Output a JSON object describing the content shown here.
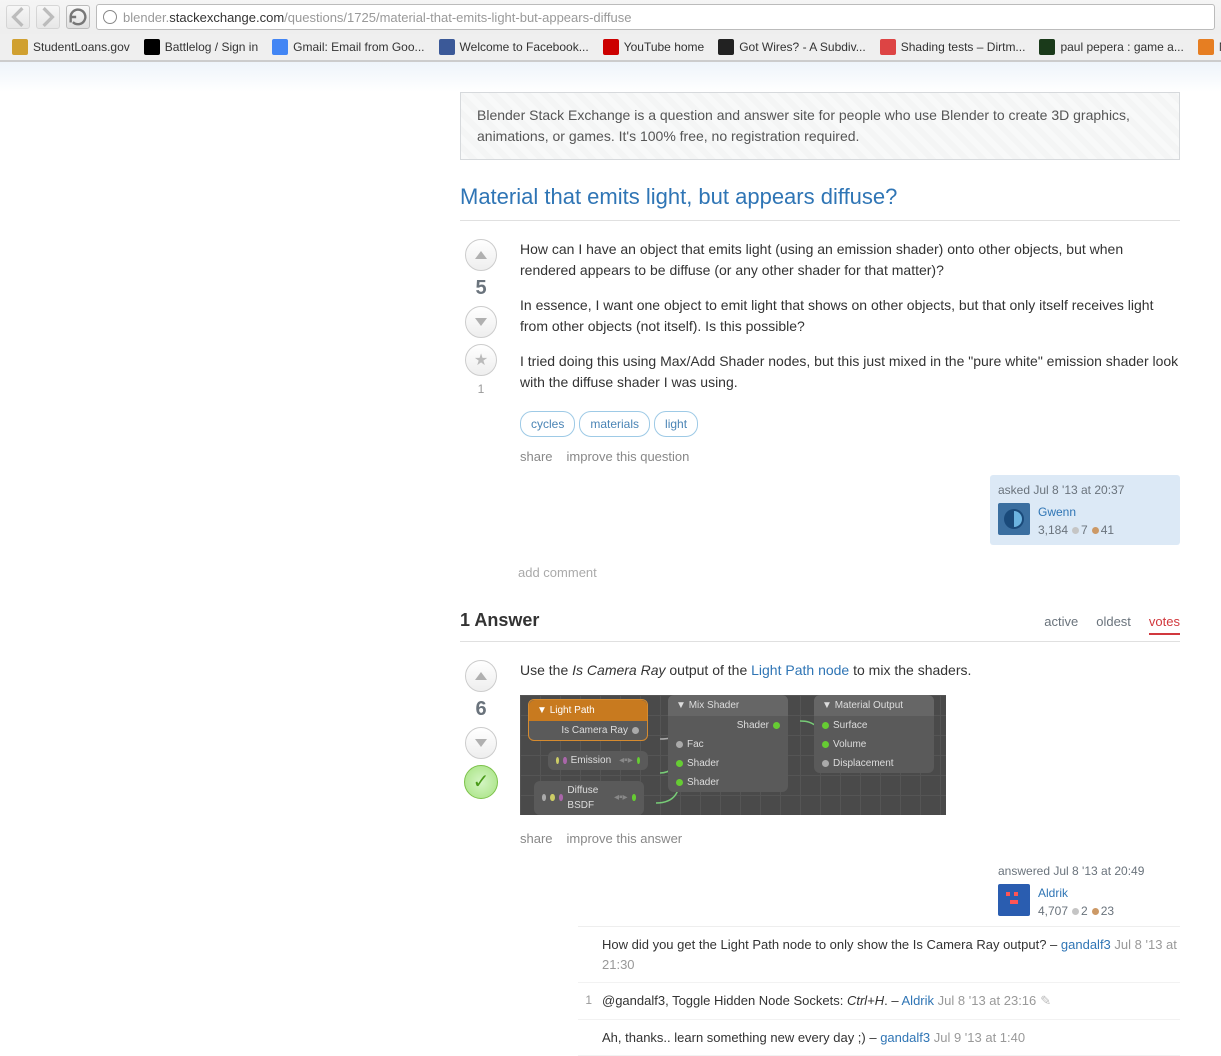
{
  "url": {
    "prefix": "blender.",
    "host": "stackexchange.com",
    "path": "/questions/1725/material-that-emits-light-but-appears-diffuse"
  },
  "bookmarks": [
    {
      "label": "StudentLoans.gov",
      "bg": "#d0a030"
    },
    {
      "label": "Battlelog / Sign in",
      "bg": "#000"
    },
    {
      "label": "Gmail: Email from Goo...",
      "bg": "#4285f4"
    },
    {
      "label": "Welcome to Facebook...",
      "bg": "#3b5998"
    },
    {
      "label": "YouTube home",
      "bg": "#cc0000"
    },
    {
      "label": "Got Wires? - A Subdiv...",
      "bg": "#222"
    },
    {
      "label": "Shading tests – Dirtm...",
      "bg": "#d44"
    },
    {
      "label": "paul pepera : game a...",
      "bg": "#1a3a1a"
    },
    {
      "label": "Modo Cookie | Modo ...",
      "bg": "#e67e22"
    }
  ],
  "blurb": "Blender Stack Exchange is a question and answer site for people who use Blender to create 3D graphics, animations, or games. It's 100% free, no registration required.",
  "question": {
    "title": "Material that emits light, but appears diffuse?",
    "score": "5",
    "fav_count": "1",
    "p1": "How can I have an object that emits light (using an emission shader) onto other objects, but when rendered appears to be diffuse (or any other shader for that matter)?",
    "p2": "In essence, I want one object to emit light that shows on other objects, but that only itself receives light from other objects (not itself). Is this possible?",
    "p3": "I tried doing this using Max/Add Shader nodes, but this just mixed in the \"pure white\" emission shader look with the diffuse shader I was using.",
    "tags": [
      "cycles",
      "materials",
      "light"
    ],
    "share": "share",
    "improve": "improve this question",
    "asked": "asked Jul 8 '13 at 20:37",
    "user": "Gwenn",
    "rep": "3,184",
    "silver": "7",
    "bronze": "41",
    "add_comment": "add comment"
  },
  "answers_header": "1 Answer",
  "sort": {
    "active": "active",
    "oldest": "oldest",
    "votes": "votes"
  },
  "answer": {
    "score": "6",
    "text_pre": "Use the ",
    "text_em": "Is Camera Ray",
    "text_mid": " output of the ",
    "text_link": "Light Path node",
    "text_post": " to mix the shaders.",
    "share": "share",
    "improve": "improve this answer",
    "answered": "answered Jul 8 '13 at 20:49",
    "user": "Aldrik",
    "rep": "4,707",
    "silver": "2",
    "bronze": "23"
  },
  "nodes": {
    "lp_title": "Light Path",
    "lp_out": "Is Camera Ray",
    "em_title": "Emission",
    "df_title": "Diffuse BSDF",
    "mix_title": "Mix Shader",
    "mix_out": "Shader",
    "mix_fac": "Fac",
    "mix_s1": "Shader",
    "mix_s2": "Shader",
    "out_title": "Material Output",
    "out_surf": "Surface",
    "out_vol": "Volume",
    "out_disp": "Displacement"
  },
  "comments": [
    {
      "score": "",
      "text": "How did you get the Light Path node to only show the Is Camera Ray output? – ",
      "user": "gandalf3",
      "time": "Jul 8 '13 at 21:30",
      "edit": false
    },
    {
      "score": "1",
      "text": "@gandalf3, Toggle Hidden Node Sockets: ",
      "kbd": "Ctrl+H",
      "sep": ". – ",
      "user": "Aldrik",
      "time": "Jul 8 '13 at 23:16",
      "edit": true
    },
    {
      "score": "",
      "text": "Ah, thanks.. learn something new every day ;) – ",
      "user": "gandalf3",
      "time": "Jul 9 '13 at 1:40",
      "edit": false
    }
  ]
}
